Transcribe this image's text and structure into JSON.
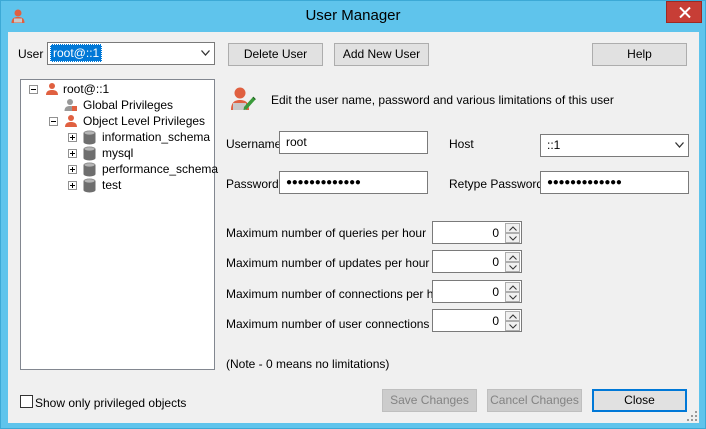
{
  "window": {
    "title": "User Manager"
  },
  "user_selector": {
    "label": "User",
    "value": "root@::1"
  },
  "toolbar": {
    "delete_user": "Delete User",
    "add_new_user": "Add New User",
    "help": "Help"
  },
  "tree": {
    "root": "root@::1",
    "global_privileges": "Global Privileges",
    "object_level_privileges": "Object Level Privileges",
    "databases": [
      "information_schema",
      "mysql",
      "performance_schema",
      "test"
    ]
  },
  "header": {
    "description": "Edit the user name, password and various limitations of this user"
  },
  "form": {
    "username_label": "Username",
    "username_value": "root",
    "host_label": "Host",
    "host_value": "::1",
    "password_label": "Password",
    "password_value": "●●●●●●●●●●●●●",
    "retype_label": "Retype Password",
    "retype_value": "●●●●●●●●●●●●●"
  },
  "limits": [
    {
      "label": "Maximum number of queries per hour",
      "value": "0"
    },
    {
      "label": "Maximum number of updates per hour",
      "value": "0"
    },
    {
      "label": "Maximum number of connections per hour",
      "value": "0"
    },
    {
      "label": "Maximum number of user connections",
      "value": "0"
    }
  ],
  "note": "(Note - 0 means no limitations)",
  "footer": {
    "show_privileged_label": "Show only privileged objects",
    "save_changes": "Save Changes",
    "cancel_changes": "Cancel Changes",
    "close": "Close"
  },
  "colors": {
    "titlebar": "#5fc4ec",
    "close_button": "#c73e36",
    "selection": "#0078d7"
  },
  "icons": [
    "user-icon",
    "global-privileges-icon",
    "object-privileges-icon",
    "database-icon",
    "edit-user-icon",
    "close-icon",
    "chevron-down-icon"
  ]
}
